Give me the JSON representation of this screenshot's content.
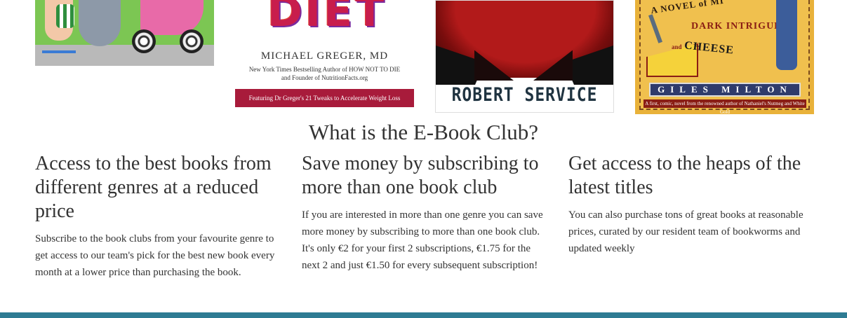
{
  "covers": [
    {
      "name": "kids-illustration"
    },
    {
      "title": "DIET",
      "author": "MICHAEL GREGER, MD",
      "subtitle_line1": "New York Times Bestselling Author of HOW NOT TO DIE",
      "subtitle_line2": "and Founder of NutritionFacts.org",
      "banner": "Featuring Dr Greger's 21 Tweaks to Accelerate Weight Loss"
    },
    {
      "author": "ROBERT SERVICE"
    },
    {
      "tag": "A NOVEL of MI",
      "line1": "DARK INTRIGUE",
      "and": "and",
      "line2": "CHEESE",
      "author": "GILES MILTON",
      "foot": "A first, comic, novel from the renowned author of Nathaniel's Nutmeg and White Gold"
    }
  ],
  "section": {
    "title": "What is the E-Book Club?"
  },
  "features": [
    {
      "heading": "Access to the best books from different genres at a reduced price",
      "body": "Subscribe to the book clubs from your favourite genre to get access to our team's pick for the best new book every month at a lower price than purchasing the book."
    },
    {
      "heading": "Save money by subscribing to more than one book club",
      "body": "If you are interested in more than one genre you can save more money by subscribing to more than one book club. It's only €2 for your first 2 subscriptions, €1.75 for the next 2 and just €1.50 for every subsequent subscription!"
    },
    {
      "heading": "Get access to the heaps of the latest titles",
      "body": "You can also purchase tons of great books at reasonable prices, curated by our resident team of bookworms and updated weekly"
    }
  ],
  "colors": {
    "footer": "#2e7b93",
    "text": "#333333"
  }
}
